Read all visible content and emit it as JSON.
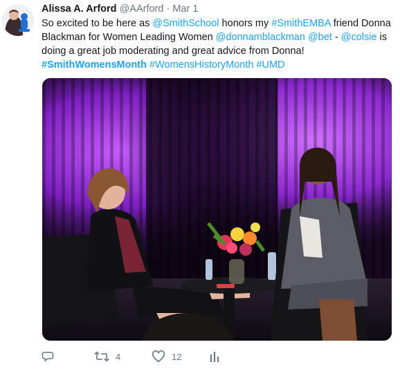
{
  "tweet": {
    "author_name": "Alissa A. Arford",
    "handle": "@AArford",
    "separator": " · ",
    "date": "Mar 1",
    "text_parts": {
      "t1": "So excited to be here as ",
      "m1": "@SmithSchool",
      "t2": " honors my ",
      "h1": "#SmithEMBA",
      "t3": " friend Donna Blackman for Women Leading Women ",
      "m2": "@donnamblackman",
      "t4": " ",
      "m3": "@bet",
      "t5": " - ",
      "m4": "@colsie",
      "t6": " is doing a great job moderating and great advice from Donna! ",
      "h2": "#SmithWomensMonth",
      "t7": " ",
      "h3": "#WomensHistoryMonth",
      "t8": " ",
      "h4": "#UMD"
    },
    "media_alt": "photo",
    "actions": {
      "reply_count": "",
      "retweet_count": "4",
      "like_count": "12"
    }
  },
  "colors": {
    "link": "#1da1f2",
    "text": "#14171a",
    "muted": "#657786"
  },
  "icons": [
    "reply-icon",
    "retweet-icon",
    "like-icon",
    "analytics-icon"
  ]
}
